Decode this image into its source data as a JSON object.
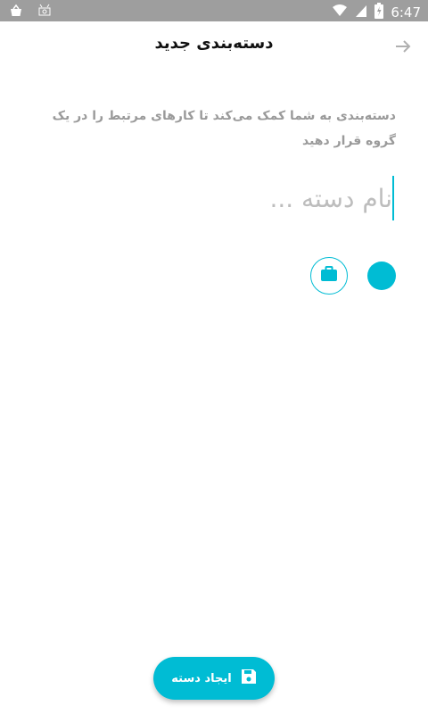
{
  "status_bar": {
    "time": "6:47",
    "left_icons": [
      "basket-icon",
      "android-debug-icon"
    ],
    "right_icons": [
      "wifi-icon",
      "signal-icon",
      "battery-icon"
    ]
  },
  "header": {
    "title": "دسته‌بندی جدید",
    "back_icon": "arrow-right-icon"
  },
  "main": {
    "description": "دسته‌بندی به شما کمک می‌کند تا کارهای مرتبط را در یک گروه قرار دهید",
    "name_input": {
      "value": "",
      "placeholder": "نام دسته ..."
    },
    "icon_option": "briefcase-icon",
    "color_option": "#00bcd4"
  },
  "fab": {
    "label": "ایجاد دسته",
    "icon": "save-icon"
  },
  "colors": {
    "accent": "#00bcd4",
    "status_bar": "#9e9e9e",
    "title": "#111111",
    "description": "#9a9a9a",
    "placeholder": "#bdbdbd"
  }
}
